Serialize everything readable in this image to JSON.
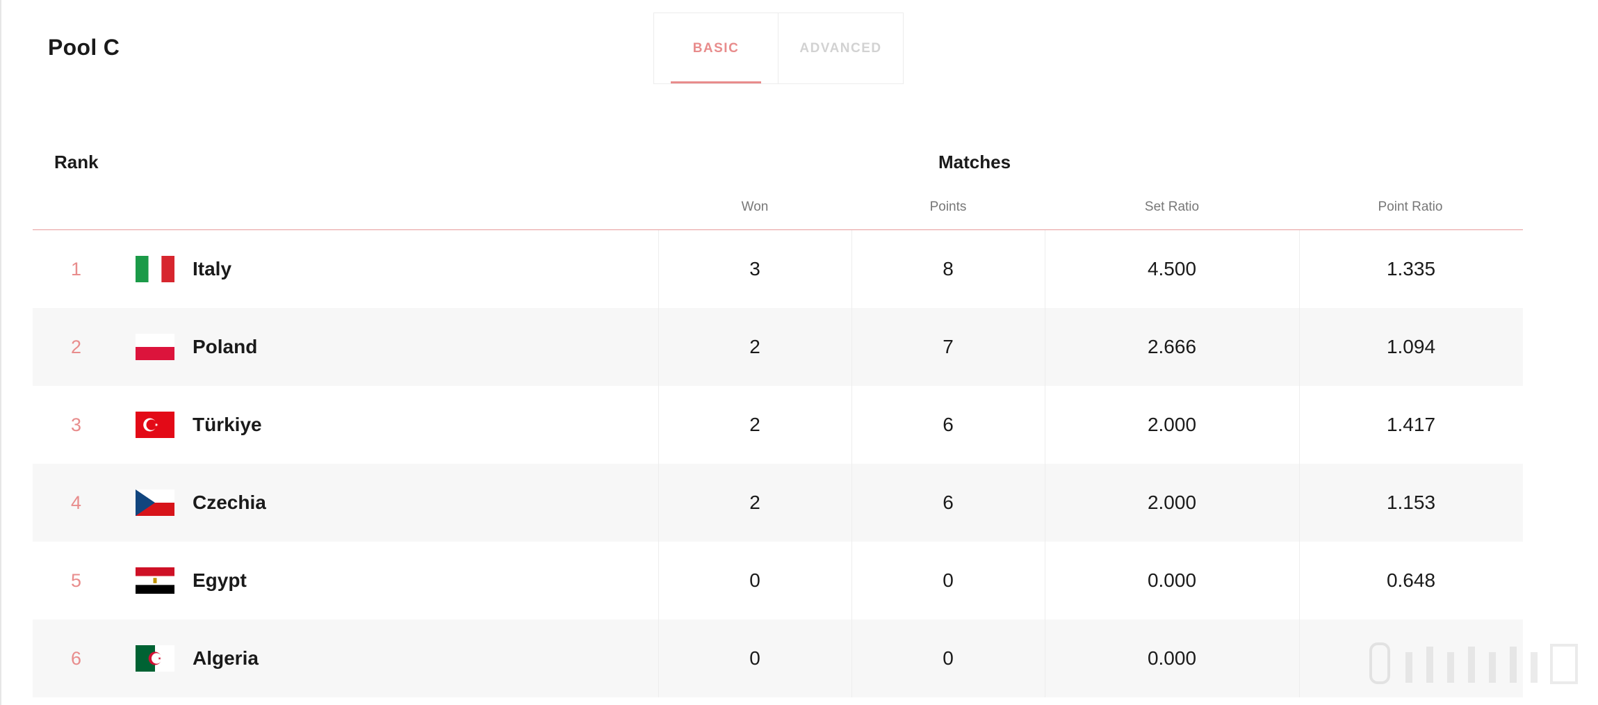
{
  "pool": {
    "title": "Pool C"
  },
  "tabs": [
    {
      "label": "BASIC",
      "active": true
    },
    {
      "label": "ADVANCED",
      "active": false
    }
  ],
  "table": {
    "rank_header": "Rank",
    "group_header": "Matches",
    "columns": [
      "Won",
      "Points",
      "Set Ratio",
      "Point Ratio"
    ],
    "rows": [
      {
        "rank": "1",
        "team": "Italy",
        "flag": "italy-flag",
        "won": "3",
        "points": "8",
        "set_ratio": "4.500",
        "point_ratio": "1.335"
      },
      {
        "rank": "2",
        "team": "Poland",
        "flag": "poland-flag",
        "won": "2",
        "points": "7",
        "set_ratio": "2.666",
        "point_ratio": "1.094"
      },
      {
        "rank": "3",
        "team": "Türkiye",
        "flag": "turkiye-flag",
        "won": "2",
        "points": "6",
        "set_ratio": "2.000",
        "point_ratio": "1.417"
      },
      {
        "rank": "4",
        "team": "Czechia",
        "flag": "czechia-flag",
        "won": "2",
        "points": "6",
        "set_ratio": "2.000",
        "point_ratio": "1.153"
      },
      {
        "rank": "5",
        "team": "Egypt",
        "flag": "egypt-flag",
        "won": "0",
        "points": "0",
        "set_ratio": "0.000",
        "point_ratio": "0.648"
      },
      {
        "rank": "6",
        "team": "Algeria",
        "flag": "algeria-flag",
        "won": "0",
        "points": "0",
        "set_ratio": "0.000",
        "point_ratio": ""
      }
    ]
  },
  "colors": {
    "accent": "#e88c8c",
    "divider": "#e79b9b",
    "alt_row": "#f7f7f7"
  }
}
